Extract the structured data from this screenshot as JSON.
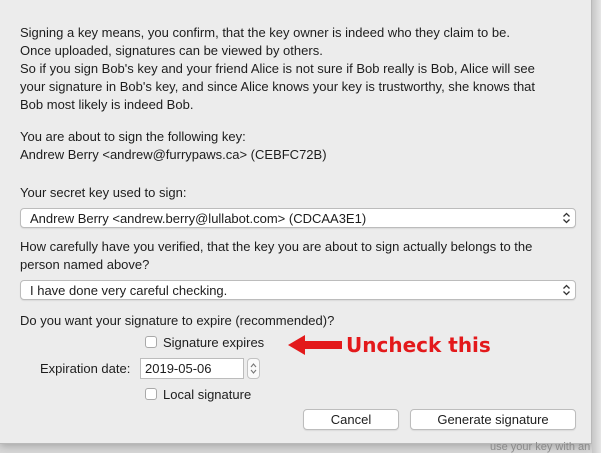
{
  "intro": {
    "line1": "Signing a key means, you confirm, that the key owner is indeed who they claim to be.",
    "line2": "Once uploaded, signatures can be viewed by others.",
    "line3": "So if you sign Bob's key and your friend Alice is not sure if Bob really is Bob, Alice will see",
    "line4": "your signature in Bob's key, and since Alice knows your key is trustworthy, she knows that",
    "line5": "Bob most likely is indeed Bob."
  },
  "target_key": {
    "label": "You are about to sign the following key:",
    "value": "Andrew Berry <andrew@furrypaws.ca> (CEBFC72B)"
  },
  "secret_key": {
    "label": "Your secret key used to sign:",
    "selected": "Andrew Berry <andrew.berry@lullabot.com> (CDCAA3E1)"
  },
  "verification": {
    "label_line1": "How carefully have you verified, that the key you are about to sign actually belongs to the",
    "label_line2": "person named above?",
    "selected": "I have done very careful checking."
  },
  "expiry": {
    "question": "Do you want your signature to expire (recommended)?",
    "checkbox_label": "Signature expires",
    "date_label": "Expiration date:",
    "date_value": "2019-05-06"
  },
  "local": {
    "checkbox_label": "Local signature"
  },
  "buttons": {
    "cancel": "Cancel",
    "generate": "Generate signature"
  },
  "annotation": {
    "text": "Uncheck this",
    "color": "#e3191b"
  },
  "background_text": "use your key with an",
  "icons": {
    "select_chevron": "chevron-updown-icon",
    "stepper": "stepper-arrows-icon",
    "annotation": "red-arrow-icon"
  }
}
